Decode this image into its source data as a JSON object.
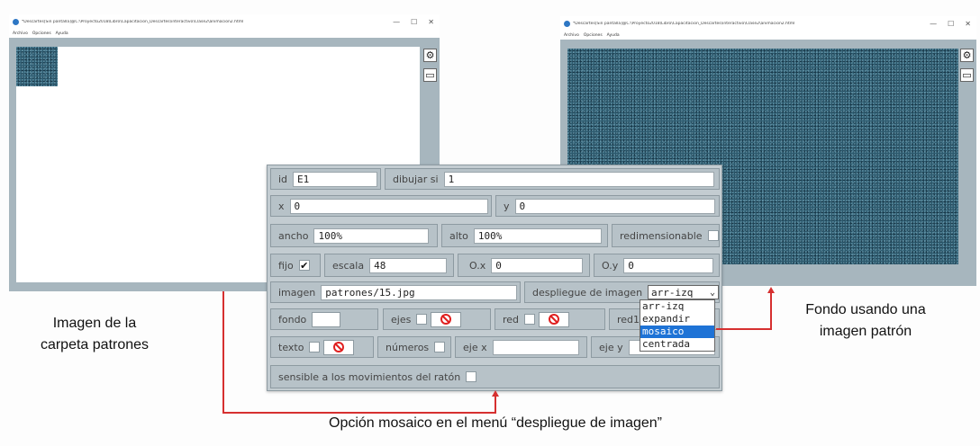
{
  "left_window": {
    "title": "*Descartes[Sin pantalla]@C:\\Proyecto2018\\Libro\\Capacitacion_Descartes\\interactivo\\Clase2\\animacion2.html",
    "menu": [
      "Archivo",
      "Opciones",
      "Ayuda"
    ],
    "controls": [
      "—",
      "☐",
      "✕"
    ]
  },
  "right_window": {
    "title": "*Descartes[Sin pantalla]@C:\\Proyecto2018\\Libro\\Capacitacion_Descartes\\interactivo\\Clase2\\animacion2.html",
    "menu": [
      "Archivo",
      "Opciones",
      "Ayuda"
    ],
    "controls": [
      "—",
      "☐",
      "✕"
    ]
  },
  "side_buttons": {
    "settings_icon": "⚙",
    "panel_icon": "▭"
  },
  "panel": {
    "id_label": "id",
    "id_value": "E1",
    "draw_if_label": "dibujar si",
    "draw_if_value": "1",
    "x_label": "x",
    "x_value": "0",
    "y_label": "y",
    "y_value": "0",
    "width_label": "ancho",
    "width_value": "100%",
    "height_label": "alto",
    "height_value": "100%",
    "resizable_label": "redimensionable",
    "fixed_label": "fijo",
    "fixed_check": "✔",
    "scale_label": "escala",
    "scale_value": "48",
    "ox_label": "O.x",
    "ox_value": "0",
    "oy_label": "O.y",
    "oy_value": "0",
    "image_label": "imagen",
    "image_value": "patrones/15.jpg",
    "display_label": "despliegue de imagen",
    "display_value": "arr-izq",
    "display_arrow": "⌄",
    "display_options": [
      "arr-izq",
      "expandir",
      "mosaico",
      "centrada"
    ],
    "display_selected": 2,
    "background_label": "fondo",
    "axes_label": "ejes",
    "grid_label": "red",
    "grid10_label": "red10",
    "text_label": "texto",
    "numbers_label": "números",
    "x_axis_label": "eje x",
    "y_axis_label": "eje y",
    "mouse_sensitive_label": "sensible a los movimientos del ratón"
  },
  "annotations": {
    "left_note": "Imagen de la carpeta patrones",
    "right_note": "Fondo usando una imagen patrón",
    "bottom_note": "Opción mosaico en el menú “despliegue de imagen”",
    "accent_color": "#d63030"
  }
}
